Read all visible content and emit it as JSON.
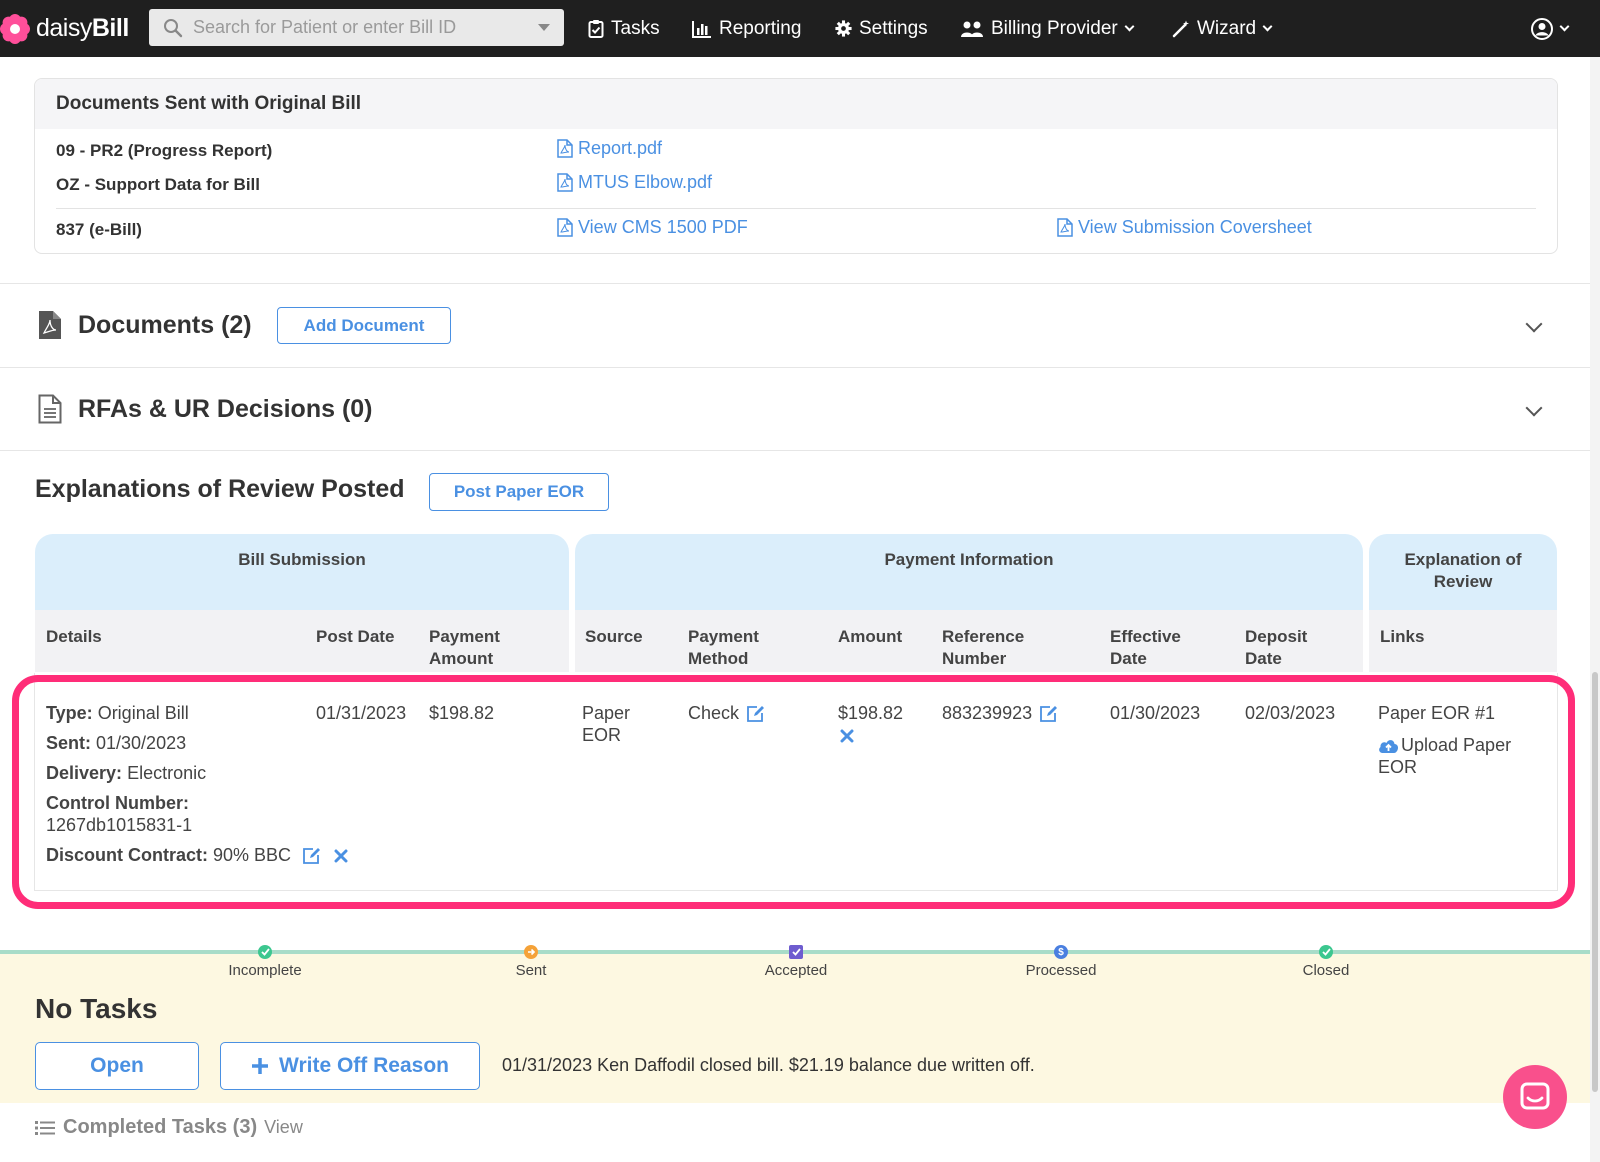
{
  "navbar": {
    "brand_light": "daisy",
    "brand_bold": "Bill",
    "search_placeholder": "Search for Patient or enter Bill ID",
    "tasks": "Tasks",
    "reporting": "Reporting",
    "settings": "Settings",
    "billing_provider": "Billing Provider",
    "wizard": "Wizard"
  },
  "docs_sent": {
    "title": "Documents Sent with Original Bill",
    "rows": [
      {
        "label": "09 - PR2 (Progress Report)",
        "link": "Report.pdf"
      },
      {
        "label": "OZ - Support Data for Bill",
        "link": "MTUS Elbow.pdf"
      },
      {
        "label": "837 (e-Bill)",
        "link": "View CMS 1500 PDF",
        "link2": "View Submission Coversheet"
      }
    ]
  },
  "documents": {
    "title": "Documents (2)",
    "button": "Add Document"
  },
  "rfas": {
    "title": "RFAs & UR Decisions (0)"
  },
  "eor": {
    "title": "Explanations of Review Posted",
    "button": "Post Paper EOR",
    "groups": {
      "bill_submission": "Bill Submission",
      "payment_information": "Payment Information",
      "explanation_line1": "Explanation of",
      "explanation_line2": "Review"
    },
    "columns": {
      "details": "Details",
      "post_date": "Post Date",
      "payment_amount_1": "Payment",
      "payment_amount_2": "Amount",
      "source": "Source",
      "payment_method_1": "Payment",
      "payment_method_2": "Method",
      "amount": "Amount",
      "reference_1": "Reference",
      "reference_2": "Number",
      "effective_1": "Effective",
      "effective_2": "Date",
      "deposit_1": "Deposit",
      "deposit_2": "Date",
      "links": "Links"
    },
    "row": {
      "type_label": "Type:",
      "type_value": "Original Bill",
      "sent_label": "Sent:",
      "sent_value": "01/30/2023",
      "delivery_label": "Delivery:",
      "delivery_value": "Electronic",
      "control_label": "Control Number:",
      "control_value": "1267db1015831-1",
      "discount_label": "Discount Contract:",
      "discount_value": "90% BBC",
      "post_date": "01/31/2023",
      "payment_amount": "$198.82",
      "source_1": "Paper",
      "source_2": "EOR",
      "payment_method": "Check",
      "amount": "$198.82",
      "reference": "883239923",
      "effective_date": "01/30/2023",
      "deposit_date": "02/03/2023",
      "link_eor": "Paper EOR #1",
      "link_upload_1": "Upload Paper",
      "link_upload_2": "EOR"
    }
  },
  "status": {
    "steps": [
      {
        "label": "Incomplete",
        "color": "#3cc78f"
      },
      {
        "label": "Sent",
        "color": "#f5a238"
      },
      {
        "label": "Accepted",
        "color": "#6e5ccf"
      },
      {
        "label": "Processed",
        "color": "#4a7fe0"
      },
      {
        "label": "Closed",
        "color": "#3cc78f"
      }
    ]
  },
  "tasks": {
    "title": "No Tasks",
    "open_button": "Open",
    "write_off_button": "Write Off Reason",
    "message": "01/31/2023 Ken Daffodil closed bill. $21.19 balance due written off.",
    "completed_label": "Completed Tasks (3)",
    "view_link": "View"
  },
  "colors": {
    "accent": "#4a90e2",
    "highlight": "#ff2d78",
    "navbar": "#1f1f1f",
    "header_blue": "#dbeefb",
    "status_panel": "#fdf8e1"
  }
}
